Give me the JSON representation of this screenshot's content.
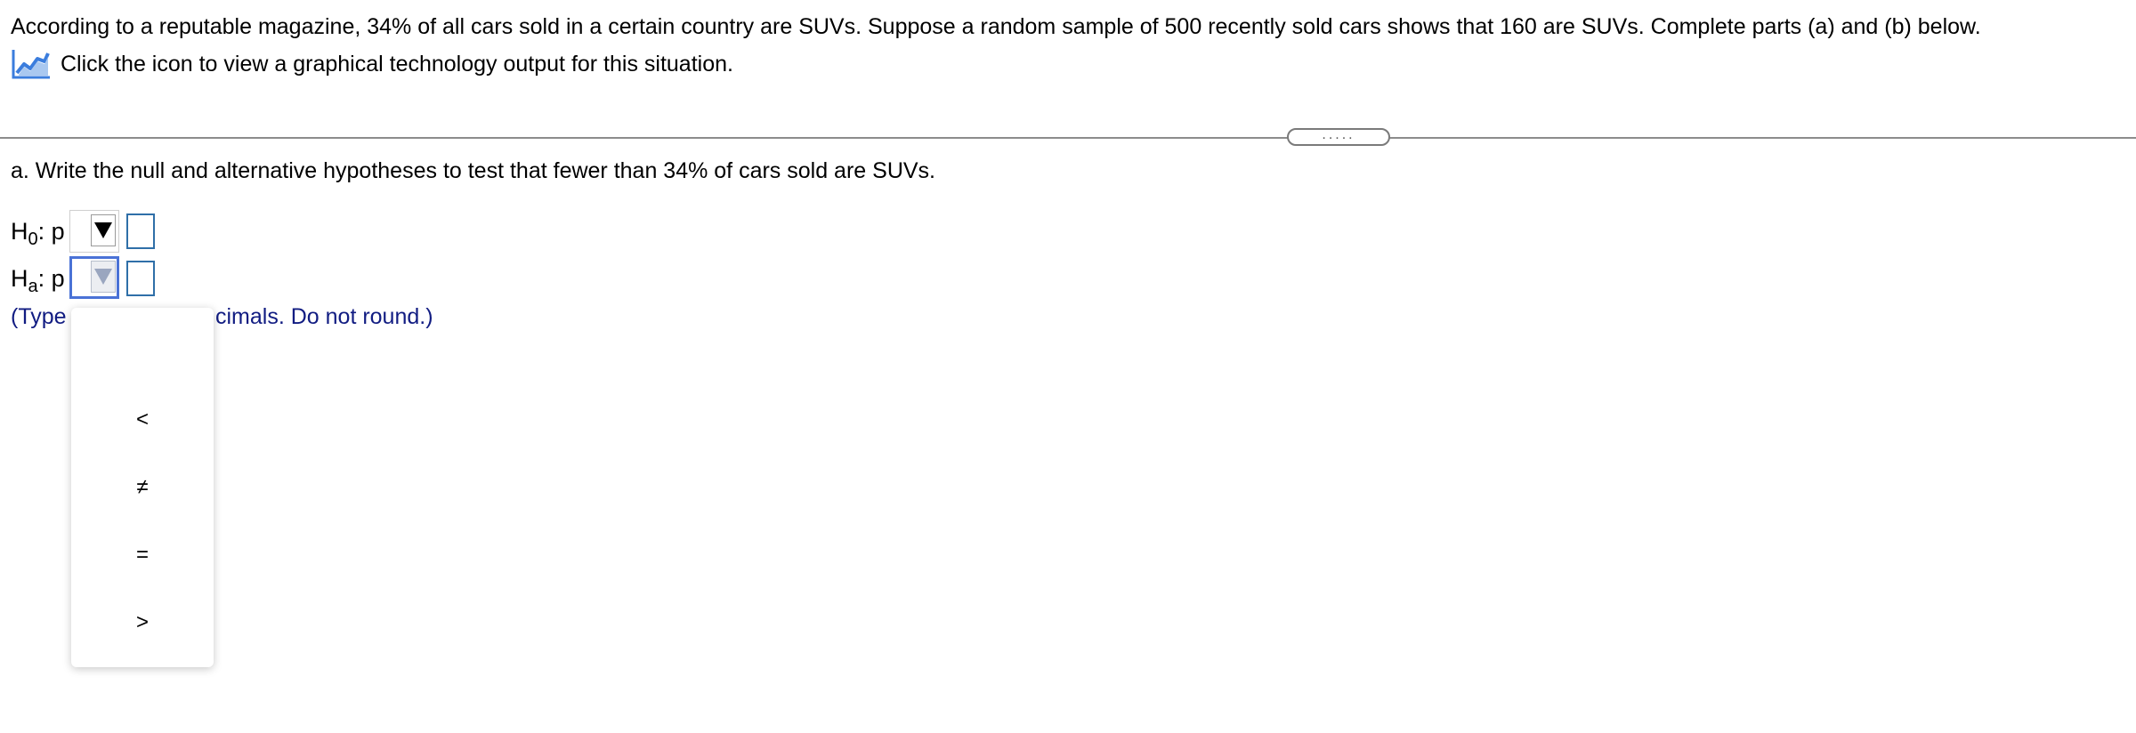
{
  "problem": {
    "statement": "According to a reputable magazine, 34% of all cars sold in a certain country are SUVs. Suppose a random sample of 500 recently sold cars shows that 160 are SUVs. Complete parts (a) and (b) below.",
    "graph_link_text": "Click the icon to view a graphical technology output for this situation.",
    "graph_icon": "line-chart-icon"
  },
  "more_handle": {
    "dots": "....."
  },
  "part_a": {
    "question": "a. Write the null and alternative hypotheses to test that fewer than 34% of cars sold are SUVs.",
    "h0": {
      "label_main": "H",
      "label_sub": "0",
      "label_tail": ": p",
      "relation_selected": "",
      "value": ""
    },
    "ha": {
      "label_main": "H",
      "label_sub": "a",
      "label_tail": ": p",
      "relation_selected": "",
      "value": ""
    },
    "instruction_head": "(Type",
    "instruction_tail": "cimals. Do not round.)"
  },
  "dropdown": {
    "options": [
      "<",
      "≠",
      "=",
      ">"
    ]
  },
  "colors": {
    "instruction_text": "#111c82",
    "focus_border": "#4a72d6",
    "answer_box_border": "#2f6fa8",
    "icon_blue": "#3b7ddd"
  }
}
